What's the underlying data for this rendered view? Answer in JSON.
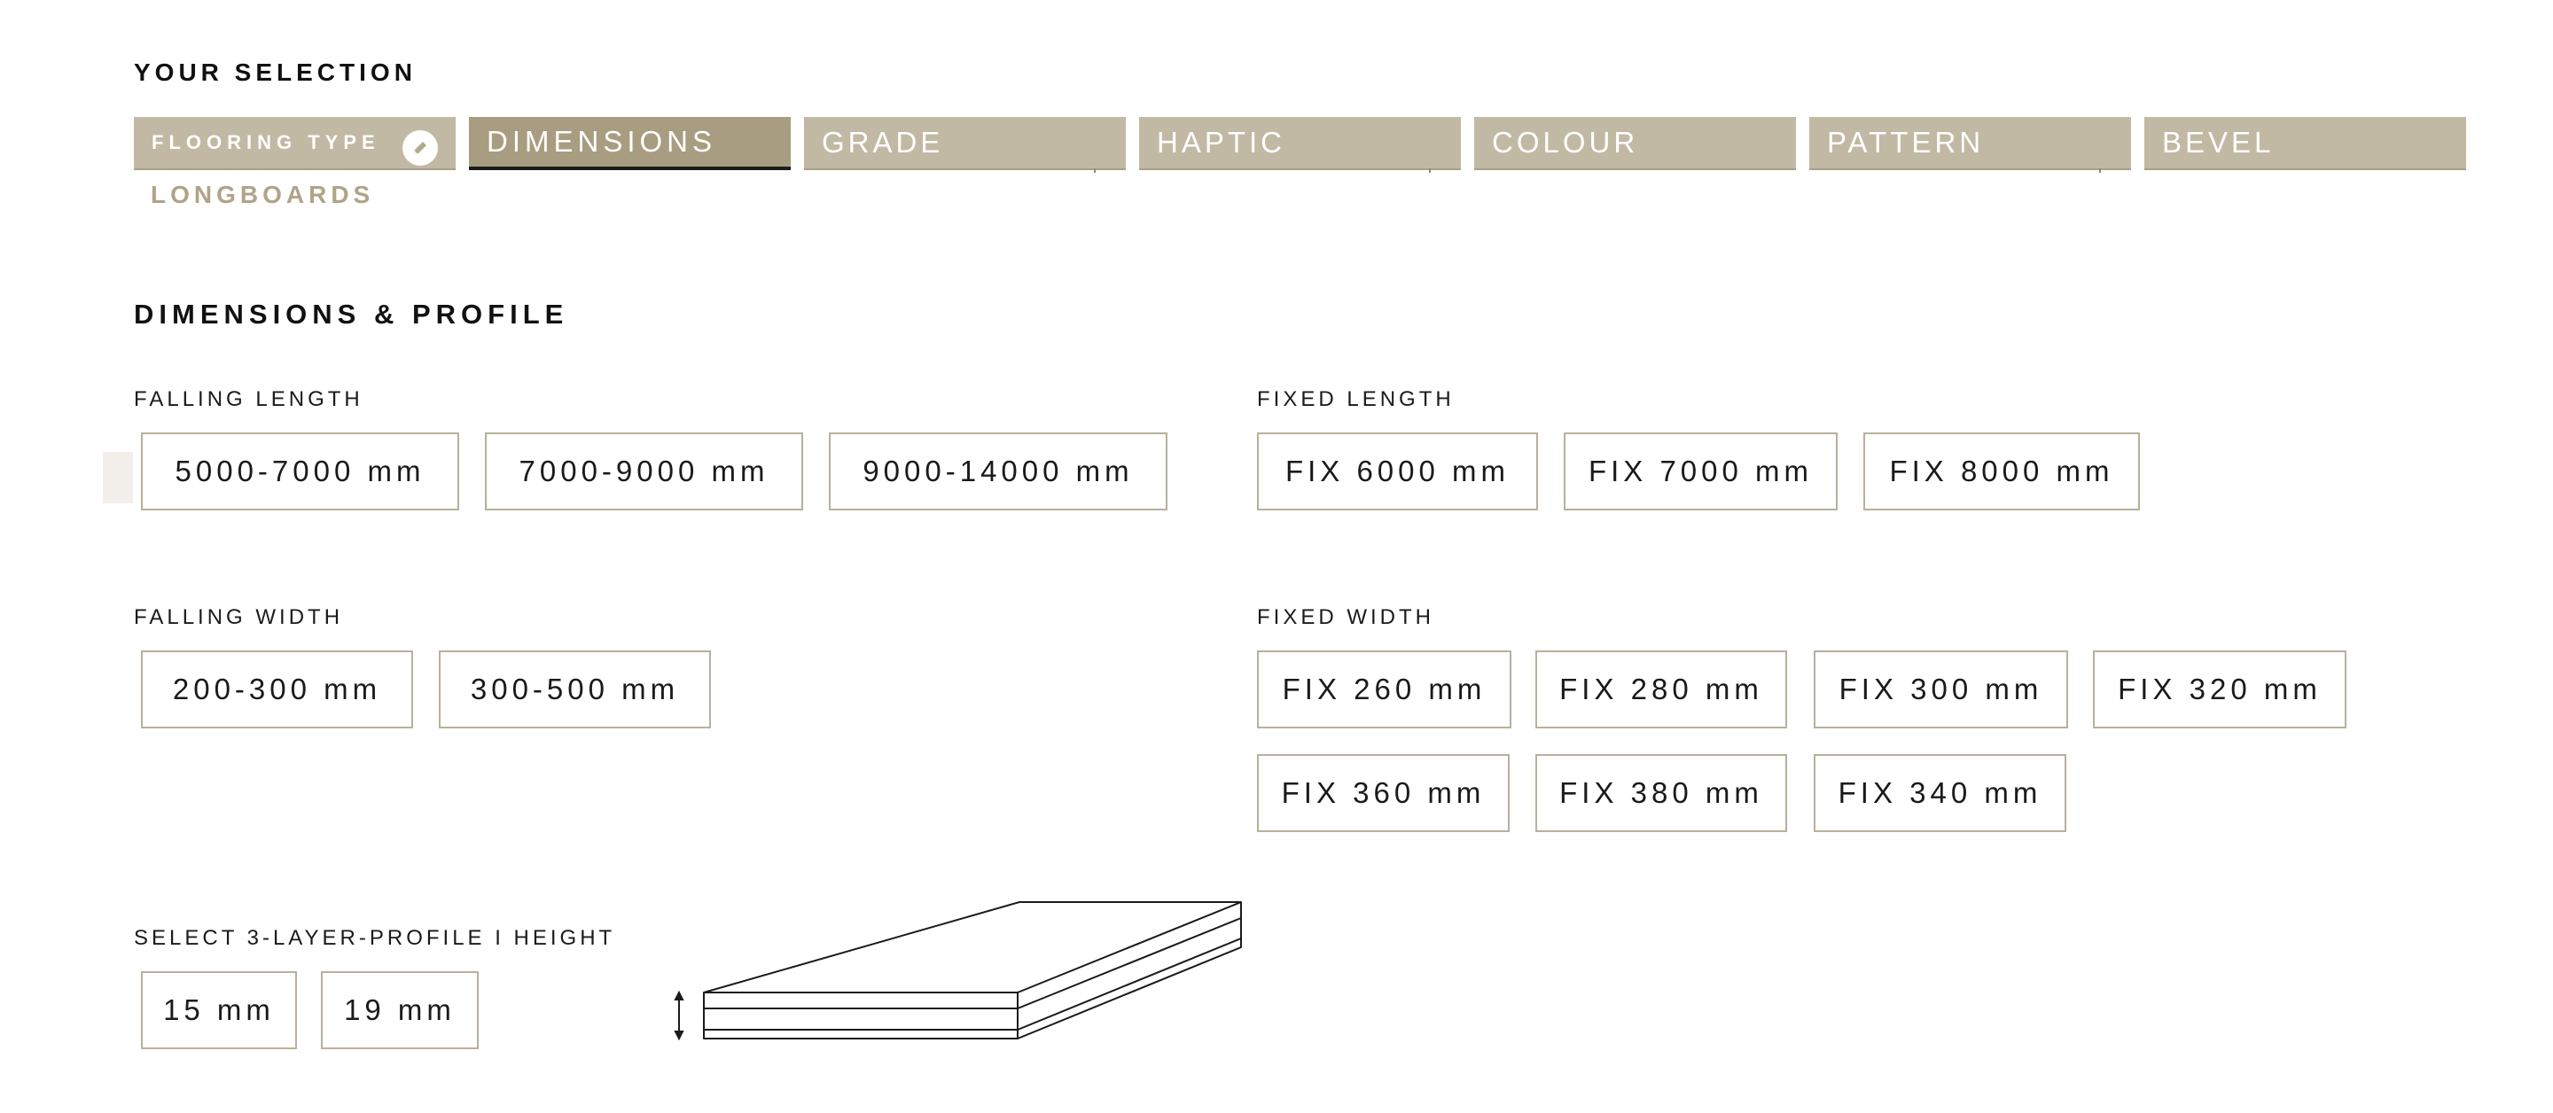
{
  "selection": {
    "heading": "YOUR SELECTION",
    "tabs": [
      {
        "label": "FLOORING TYPE",
        "state": "completed",
        "selected_value": "LONGBOARDS",
        "icon": "edit-pencil-icon"
      },
      {
        "label": "DIMENSIONS",
        "state": "active"
      },
      {
        "label": "GRADE",
        "state": "pending"
      },
      {
        "label": "HAPTIC",
        "state": "pending"
      },
      {
        "label": "COLOUR",
        "state": "pending"
      },
      {
        "label": "PATTERN",
        "state": "pending"
      },
      {
        "label": "BEVEL",
        "state": "pending"
      }
    ]
  },
  "section": {
    "title": "DIMENSIONS & PROFILE"
  },
  "falling_length": {
    "label": "FALLING LENGTH",
    "options": [
      "5000-7000 mm",
      "7000-9000 mm",
      "9000-14000 mm"
    ]
  },
  "fixed_length": {
    "label": "FIXED LENGTH",
    "options": [
      "FIX 6000 mm",
      "FIX 7000 mm",
      "FIX 8000 mm"
    ]
  },
  "falling_width": {
    "label": "FALLING WIDTH",
    "options": [
      "200-300 mm",
      "300-500 mm"
    ]
  },
  "fixed_width": {
    "label": "FIXED WIDTH",
    "options": [
      "FIX 260 mm",
      "FIX 280 mm",
      "FIX 300 mm",
      "FIX 320 mm",
      "FIX 360 mm",
      "FIX 380 mm",
      "FIX 340 mm"
    ]
  },
  "profile": {
    "label": "SELECT 3-LAYER-PROFILE I HEIGHT",
    "options": [
      "15 mm",
      "19 mm"
    ]
  },
  "colors": {
    "tab_bg": "#c2b9a4",
    "tab_active_bg": "#a89d80",
    "accent_text": "#b0a488",
    "chip_border": "#b8b09c"
  }
}
